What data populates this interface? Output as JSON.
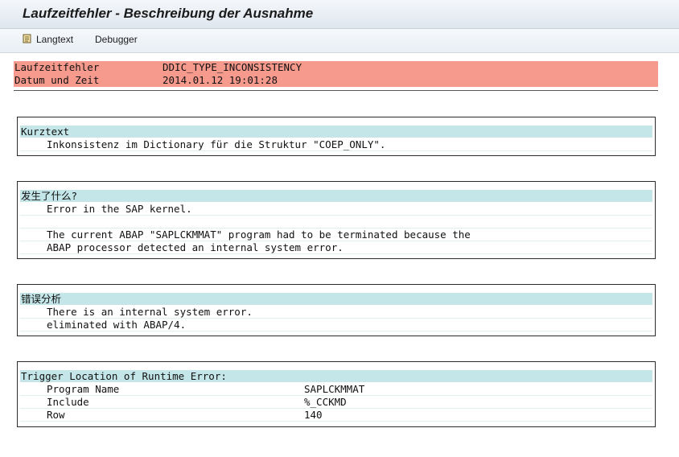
{
  "title": "Laufzeitfehler - Beschreibung der Ausnahme",
  "toolbar": {
    "langtext_label": "Langtext",
    "debugger_label": "Debugger"
  },
  "header": {
    "rows": [
      {
        "label": "Laufzeitfehler",
        "value": "DDIC_TYPE_INCONSISTENCY"
      },
      {
        "label": "Datum und Zeit",
        "value": "2014.01.12 19:01:28"
      }
    ]
  },
  "sections": {
    "kurztext": {
      "heading": "Kurztext",
      "lines": [
        "Inkonsistenz im Dictionary für die Struktur \"COEP_ONLY\"."
      ]
    },
    "what_happened": {
      "heading": "发生了什么?",
      "lines": [
        "Error in the SAP kernel.",
        "",
        "The current ABAP \"SAPLCKMMAT\" program had to be terminated because the",
        "ABAP processor detected an internal system error."
      ]
    },
    "error_analysis": {
      "heading": "错误分析",
      "lines": [
        "There is an internal system error.",
        "eliminated with ABAP/4."
      ]
    },
    "trigger_location": {
      "heading": "Trigger Location of Runtime Error:",
      "rows": [
        {
          "label": "Program Name",
          "value": "SAPLCKMMAT"
        },
        {
          "label": "Include",
          "value": "%_CCKMD"
        },
        {
          "label": "Row",
          "value": "140"
        }
      ]
    }
  },
  "colors": {
    "header_row": "#f79a8e",
    "section_heading": "#c4e6e8"
  }
}
